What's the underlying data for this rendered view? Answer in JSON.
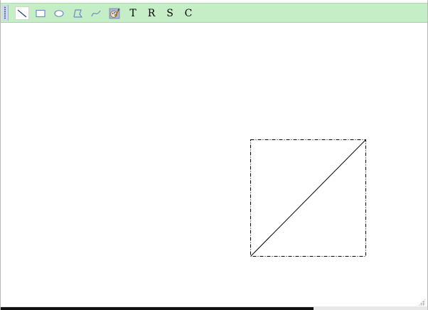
{
  "toolbar": {
    "tools": [
      {
        "name": "line-tool",
        "icon": "line-icon"
      },
      {
        "name": "rectangle-tool",
        "icon": "rectangle-icon"
      },
      {
        "name": "ellipse-tool",
        "icon": "ellipse-icon"
      },
      {
        "name": "polygon-tool",
        "icon": "polygon-icon"
      },
      {
        "name": "curve-tool",
        "icon": "curve-icon"
      },
      {
        "name": "palette-tool",
        "icon": "palette-icon"
      }
    ],
    "letter_tools": {
      "t_label": "T",
      "r_label": "R",
      "s_label": "S",
      "c_label": "C"
    },
    "accent_color": "#c6eec6",
    "icon_color": "#6a8cc7"
  },
  "canvas": {
    "background": "#ffffff",
    "shapes": [
      {
        "type": "line",
        "selected": true,
        "stroke": "#000000"
      }
    ]
  }
}
